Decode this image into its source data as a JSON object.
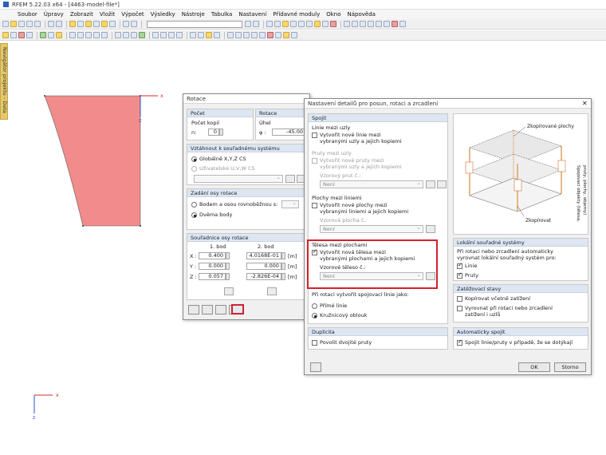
{
  "app": {
    "title": "RFEM 5.22.03 x64 - [4463-model-file*]"
  },
  "menu": [
    "Soubor",
    "Úpravy",
    "Zobrazit",
    "Vložit",
    "Výpočet",
    "Výsledky",
    "Nástroje",
    "Tabulka",
    "Nastavení",
    "Přídavné moduly",
    "Okno",
    "Nápověda"
  ],
  "navigator": {
    "label": "Navigátor projektu - Data"
  },
  "axes": {
    "x": "x",
    "z": "z"
  },
  "colors": {
    "shape": "#f28b8b",
    "accent": "#d5202a",
    "header": "#dde6f1"
  },
  "rot": {
    "title": "Rotace",
    "pocet": {
      "header": "Počet",
      "label": "Počet kopií",
      "n_label": "n:",
      "n_value": "0"
    },
    "rotace": {
      "header": "Rotace",
      "label": "Úhel",
      "phi_label": "φ :",
      "phi_value": "-45.00"
    },
    "cs": {
      "header": "Vztáhnout k souřadnému systému",
      "global": "Globálně X,Y,Z CS",
      "user": "Uživatelské U,V,W CS"
    },
    "axis": {
      "header": "Zadání osy rotace",
      "opt1": "Bodem a osou rovnoběžnou s:",
      "opt2": "Dvěma body"
    },
    "coords": {
      "header": "Souřadnice osy rotace",
      "col1": "1. bod",
      "col2": "2. bod",
      "rows": [
        {
          "label": "X :",
          "p1": "0.400",
          "p2": "4.0168E-01",
          "unit": "[m]"
        },
        {
          "label": "Y :",
          "p1": "0.000",
          "p2": "0.000",
          "unit": "[m]"
        },
        {
          "label": "Z :",
          "p1": "0.057",
          "p2": "-2.826E-04",
          "unit": "[m]"
        }
      ]
    }
  },
  "det": {
    "title": "Nastavení detailů pro posun, rotaci a zrcadlení",
    "spojit": {
      "header": "Spojit",
      "linie_title": "Linie mezi uzly",
      "linie_cb": "Vytvořit nové linie mezi",
      "linie_cb2": "vybranými uzly a jejich kopiemi",
      "pruty_title": "Pruty mezi uzly",
      "pruty_cb": "Vytvořit nové pruty mezi",
      "pruty_cb2": "vybranými uzly a jejich kopiemi",
      "prut_label": "Vzorový prut č.:",
      "prut_value": "Není",
      "plochy_title": "Plochy mezi liniemi",
      "plochy_cb": "Vytvořit nové plochy mezi",
      "plochy_cb2": "vybranými liniemi a jejich kopiemi",
      "plocha_label": "Vzorová plocha č.:",
      "plocha_value": "Není",
      "telesa_title": "Tělesa mezi plochami",
      "telesa_cb": "Vytvořit nová tělesa mezi",
      "telesa_cb2": "vybranými plochami a jejich kopiemi",
      "teleso_label": "Vzorové těleso č.:",
      "teleso_value": "Není",
      "rot_label": "Při rotaci vytvořit spojovací linie jako:",
      "rot_opt1": "Přímé linie",
      "rot_opt2": "Kružnicový oblouk"
    },
    "dup": {
      "header": "Duplicita",
      "cb": "Povolit dvojité pruty"
    },
    "illus": {
      "top": "Zkopírované plochy",
      "side": "Spojovací objekty (tělesa,",
      "side2": "pruty, plochy, objemy)",
      "bottom": "Zkopírovat"
    },
    "lok": {
      "header": "Lokální souřadné systémy",
      "text1": "Při rotaci nebo zrcadlení automaticky",
      "text2": "vyrovnat lokální souřadný systém pro:",
      "cb1": "Linie",
      "cb2": "Pruty"
    },
    "zat": {
      "header": "Zatěžovací stavy",
      "cb1": "Kopírovat včetně zatížení",
      "cb2": "Vyrovnat při rotaci nebo zrcadlení",
      "cb2b": "zatížení i uzlů"
    },
    "auto": {
      "header": "Automaticky spojit",
      "cb": "Spojit linie/pruty v případě, že se dotýkají"
    },
    "ok": "OK",
    "cancel": "Storno"
  }
}
